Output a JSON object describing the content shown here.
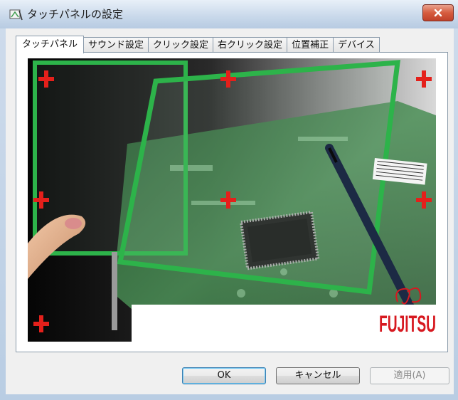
{
  "window": {
    "title": "タッチパネルの設定",
    "icon": "touch-panel-settings-icon",
    "close_icon": "close-x-icon"
  },
  "tabs": [
    {
      "label": "タッチパネル",
      "active": true
    },
    {
      "label": "サウンド設定",
      "active": false
    },
    {
      "label": "クリック設定",
      "active": false
    },
    {
      "label": "右クリック設定",
      "active": false
    },
    {
      "label": "位置補正",
      "active": false
    },
    {
      "label": "デバイス",
      "active": false
    }
  ],
  "panel": {
    "brand_logo_text": "FUJITSU",
    "calibration_marker_icon": "red-plus-icon",
    "calibration_marker_color": "#e4201b",
    "accent_green": "#2db34a"
  },
  "buttons": {
    "ok_label": "OK",
    "cancel_label": "キャンセル",
    "apply_label": "適用(A)",
    "apply_enabled": false
  }
}
